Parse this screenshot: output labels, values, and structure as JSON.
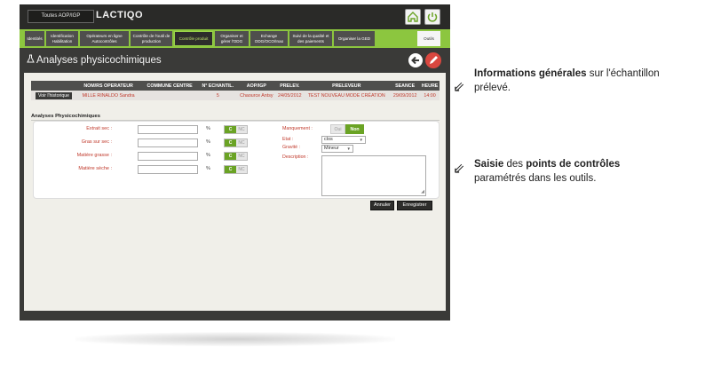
{
  "header": {
    "aop_button": "Toutes AOP/IGP",
    "brand": "LACTIQO",
    "home_icon": "home-icon",
    "power_icon": "power-icon"
  },
  "nav": {
    "items": [
      {
        "label": "Identités"
      },
      {
        "label": "Identification Habilitation"
      },
      {
        "label": "Opérateurs en ligne Autocontrôles"
      },
      {
        "label": "Contrôle de l'outil de production"
      },
      {
        "label": "Contrôle produit"
      },
      {
        "label": "Organiser et gérer l'ODG"
      },
      {
        "label": "Echange ODG/OCO/Inao"
      },
      {
        "label": "Suivi de la qualité et des paiements"
      },
      {
        "label": "Organiser la GED"
      }
    ],
    "outils": "Outils"
  },
  "page": {
    "title": "Analyses physicochimiques"
  },
  "table": {
    "headers": [
      "",
      "NOM/RS OPERATEUR",
      "COMMUNE CENTRE",
      "N° ECHANTIL.",
      "AOP/IGP",
      "PRELEV.",
      "PRELEVEUR",
      "SEANCE",
      "HEURE"
    ],
    "row": {
      "history_button": "Voir l'historique",
      "operator": "MILLE RINALDO Sandra",
      "commune": "",
      "echantil": "5",
      "aop": "Chaource Antsy",
      "prelev": "24/05/2012",
      "preleveur": "TEST NOUVEAU MODE CRÉATION",
      "seance": "29/09/2012",
      "heure": "14:00"
    }
  },
  "form": {
    "section_title": "Analyses Physicochimiques",
    "fields": [
      {
        "label": "Extrait sec :",
        "unit": "%",
        "c": "C",
        "nc": "NC"
      },
      {
        "label": "Gras sur sec :",
        "unit": "%",
        "c": "C",
        "nc": "NC"
      },
      {
        "label": "Matière grasse :",
        "unit": "%",
        "c": "C",
        "nc": "NC"
      },
      {
        "label": "Matière sèche :",
        "unit": "%",
        "c": "C",
        "nc": "NC"
      }
    ],
    "manquement_label": "Manquement :",
    "manquement_oui": "Oui",
    "manquement_non": "Non",
    "etat_label": "Etat :",
    "etat_value": "clos",
    "gravite_label": "Gravité :",
    "gravite_value": "Mineur",
    "description_label": "Description :",
    "annuler": "Annuler",
    "enregistrer": "Enregistrer"
  },
  "annotations": {
    "info_bold": "Informations générales",
    "info_rest": " sur l'échantillon",
    "info_line2": "prélevé.",
    "saisie_bold": "Saisie",
    "saisie_mid": " des ",
    "saisie_bold2": "points de contrôles",
    "saisie_line2": "paramétrés dans les outils."
  }
}
